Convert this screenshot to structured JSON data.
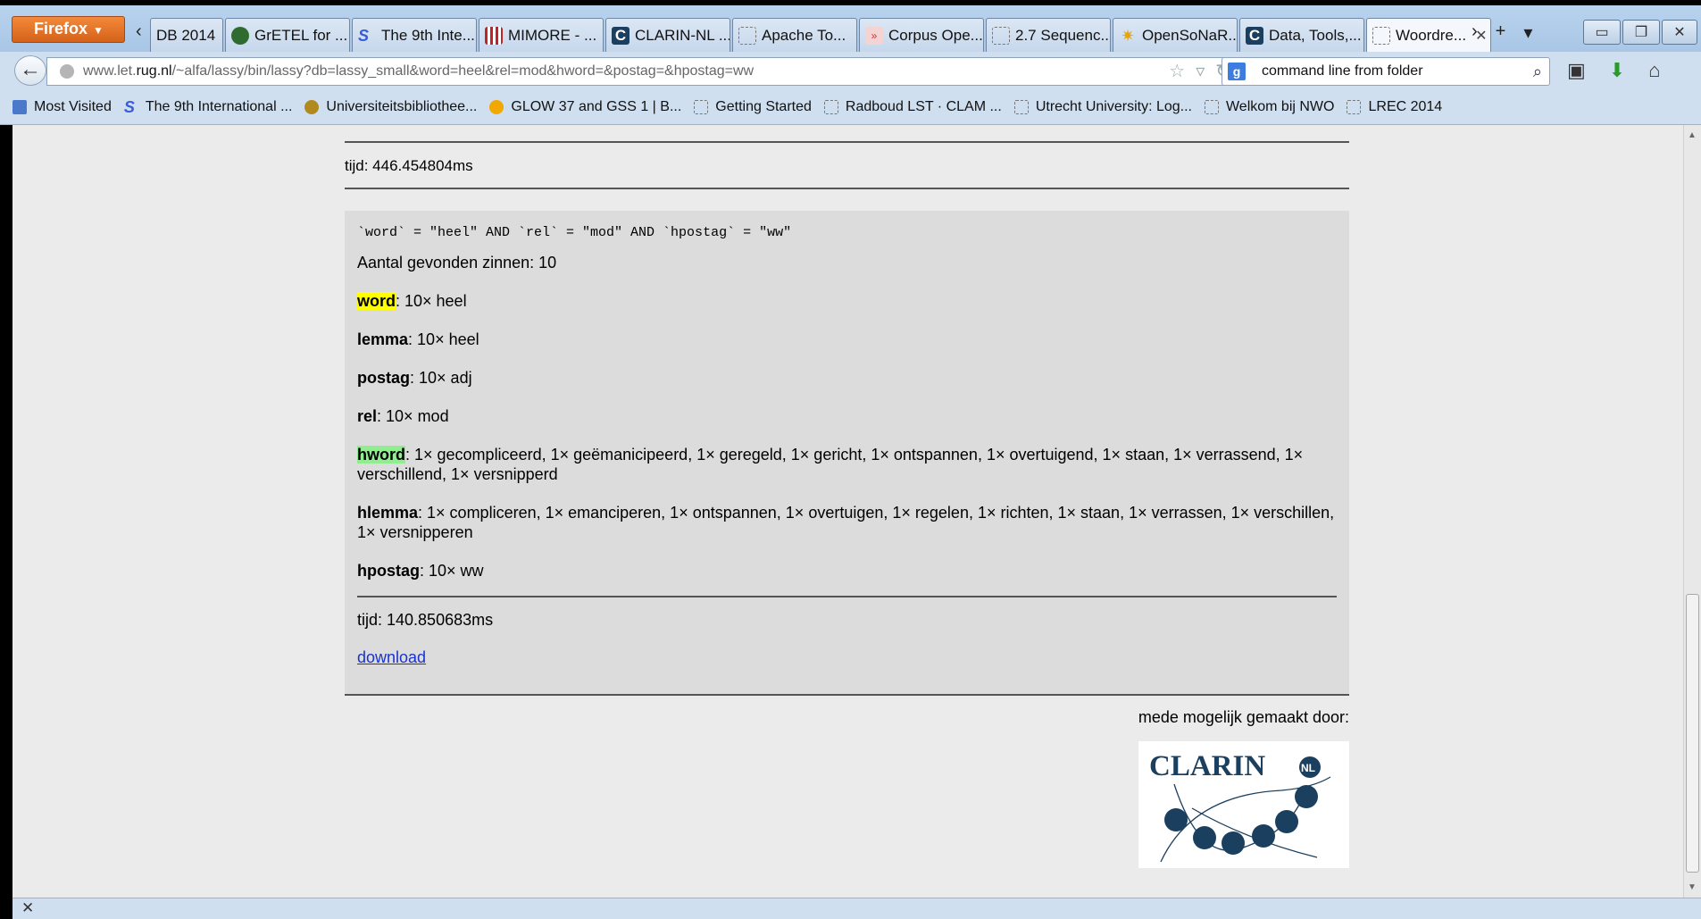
{
  "browser": {
    "menu_label": "Firefox",
    "tabs": [
      {
        "label": "DB 2014",
        "icon": "tab-scroll"
      },
      {
        "label": "GrETEL for ...",
        "icon": "tree-icon"
      },
      {
        "label": "The 9th Inte...",
        "icon": "s-logo-icon"
      },
      {
        "label": "MIMORE - ...",
        "icon": "bars-icon"
      },
      {
        "label": "CLARIN-NL ...",
        "icon": "c-logo-icon"
      },
      {
        "label": "Apache To...",
        "icon": "blank-page-icon"
      },
      {
        "label": "Corpus Ope...",
        "icon": "pdf-icon"
      },
      {
        "label": "2.7 Sequenc...",
        "icon": "blank-page-icon"
      },
      {
        "label": "OpenSoNaR...",
        "icon": "star-burst-icon"
      },
      {
        "label": "Data, Tools,...",
        "icon": "c-logo-icon"
      },
      {
        "label": "Woordre...",
        "icon": "blank-page-icon"
      }
    ],
    "url_prefix": "www.let.",
    "url_domain": "rug.nl",
    "url_rest": "/~alfa/lassy/bin/lassy?db=lassy_small&word=heel&rel=mod&hword=&postag=&hpostag=ww",
    "search_value": "command line from folder",
    "bookmarks": [
      "Most Visited",
      "The 9th International ...",
      "Universiteitsbibliothee...",
      "GLOW 37 and GSS 1 | B...",
      "Getting Started",
      "Radboud LST · CLAM ...",
      "Utrecht University: Log...",
      "Welkom bij NWO",
      "LREC 2014"
    ]
  },
  "page": {
    "tijd_top": "tijd: 446.454804ms",
    "query": "`word` = \"heel\" AND `rel` = \"mod\" AND `hpostag` = \"ww\"",
    "count_line": "Aantal gevonden zinnen: 10",
    "rows": [
      {
        "key": "word",
        "value": ": 10× heel",
        "highlight": "#ffff00"
      },
      {
        "key": "lemma",
        "value": ": 10× heel"
      },
      {
        "key": "postag",
        "value": ": 10× adj"
      },
      {
        "key": "rel",
        "value": ": 10× mod"
      },
      {
        "key": "hword",
        "value": ": 1× gecompliceerd, 1× geëmanicipeerd, 1× geregeld, 1× gericht, 1× ontspannen, 1× overtuigend, 1× staan, 1× verrassend, 1× verschillend, 1× versnipperd",
        "highlight": "#90ee90"
      },
      {
        "key": "hlemma",
        "value": ": 1× compliceren, 1× emanciperen, 1× ontspannen, 1× overtuigen, 1× regelen, 1× richten, 1× staan, 1× verrassen, 1× verschillen, 1× versnipperen"
      },
      {
        "key": "hpostag",
        "value": ": 10× ww"
      }
    ],
    "tijd_bottom": "tijd: 140.850683ms",
    "download_label": "download",
    "credit": "mede mogelijk gemaakt door:",
    "logo_text": "CLARIN",
    "logo_badge": "NL"
  },
  "colors": {
    "link": "#1a33cc",
    "logo_navy": "#1b3f5e"
  }
}
